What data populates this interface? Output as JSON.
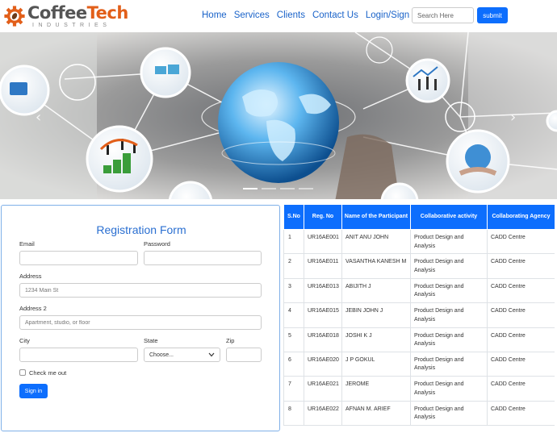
{
  "navbar": {
    "brand": {
      "name_part1": "Coffee",
      "name_part2": "Tech",
      "tagline": "INDUSTRIES"
    },
    "links": [
      "Home",
      "Services",
      "Clients",
      "Contact Us",
      "Login/Sign Up"
    ],
    "search_placeholder": "Search Here",
    "submit_label": "submit"
  },
  "hero": {
    "prev_icon": "‹",
    "next_icon": "›",
    "indicator_count": 4,
    "active_indicator": 0
  },
  "form": {
    "title": "Registration Form",
    "email_label": "Email",
    "password_label": "Password",
    "address_label": "Address",
    "address_placeholder": "1234 Main St",
    "address2_label": "Address 2",
    "address2_placeholder": "Apartment, studio, or floor",
    "city_label": "City",
    "state_label": "State",
    "state_selected": "Choose...",
    "zip_label": "Zip",
    "checkbox_label": "Check me out",
    "signin_label": "Sign in"
  },
  "table": {
    "headers": [
      "S.No",
      "Reg. No",
      "Name of the Participant",
      "Collaborative activity",
      "Collaborating Agency"
    ],
    "rows": [
      [
        "1",
        "UR16AE001",
        "ANIT ANU JOHN",
        "Product Design and Analysis",
        "CADD Centre"
      ],
      [
        "2",
        "UR16AE011",
        "VASANTHA KANESH M",
        "Product Design and Analysis",
        "CADD Centre"
      ],
      [
        "3",
        "UR16AE013",
        "ABIJITH J",
        "Product Design and Analysis",
        "CADD Centre"
      ],
      [
        "4",
        "UR16AE015",
        "JEBIN JOHN J",
        "Product Design and Analysis",
        "CADD Centre"
      ],
      [
        "5",
        "UR16AE018",
        "JOSHI K J",
        "Product Design and Analysis",
        "CADD Centre"
      ],
      [
        "6",
        "UR16AE020",
        "J P GOKUL",
        "Product Design and Analysis",
        "CADD Centre"
      ],
      [
        "7",
        "UR16AE021",
        "JEROME",
        "Product Design and Analysis",
        "CADD Centre"
      ],
      [
        "8",
        "UR16AE022",
        "AFNAN M. ARIEF",
        "Product Design and Analysis",
        "CADD Centre"
      ]
    ]
  },
  "colors": {
    "accent": "#0d6efd",
    "brand_orange": "#e25f1a",
    "link": "#1a63c9"
  }
}
